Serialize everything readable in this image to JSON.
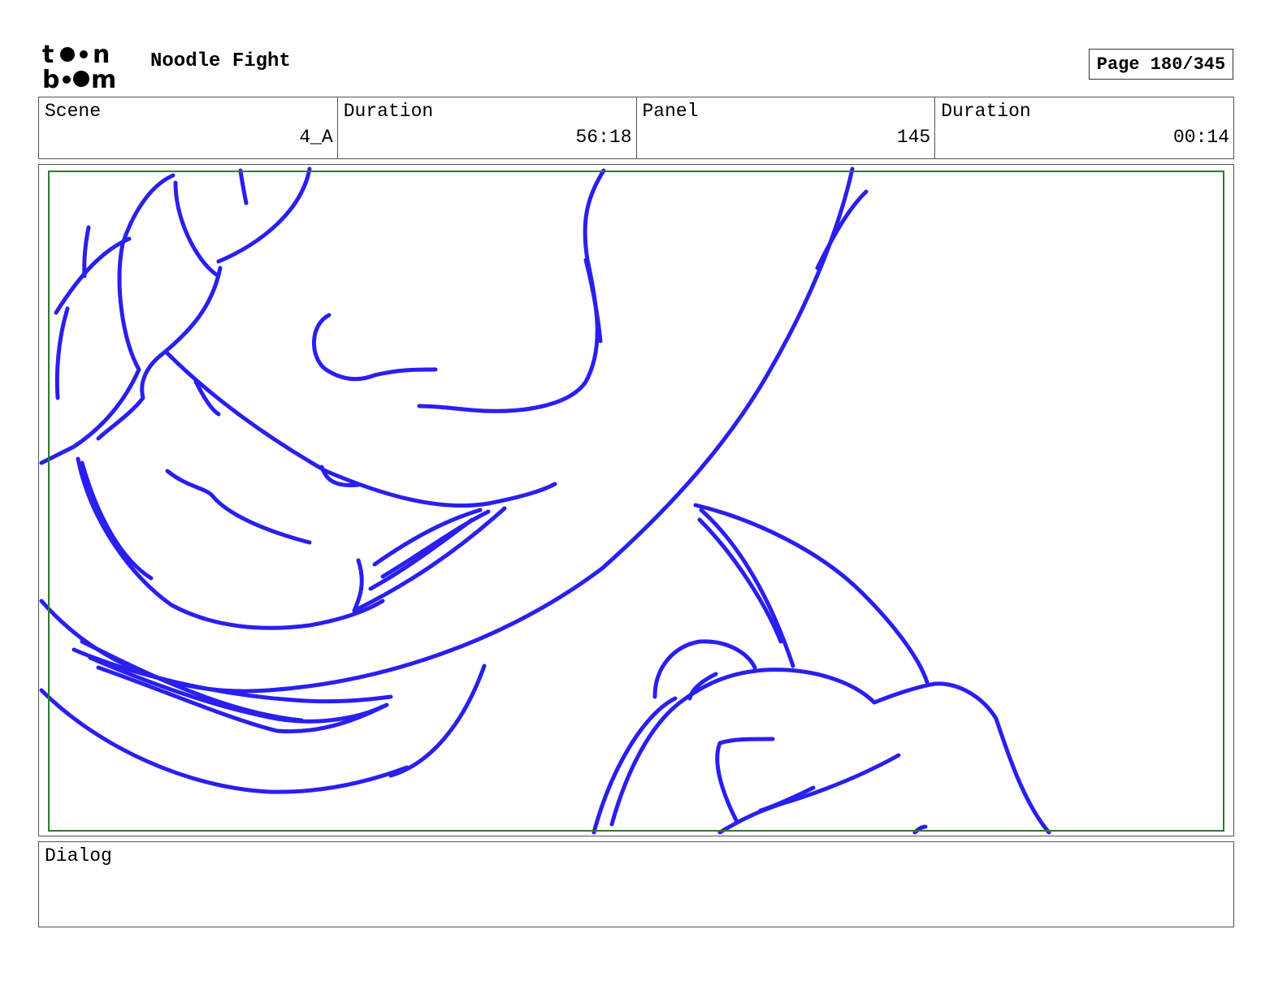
{
  "header": {
    "logo_top": "t●●n",
    "logo_bottom": "b●●m",
    "project_title": "Noodle Fight",
    "page_label": "Page 180/345"
  },
  "info": {
    "scene_label": "Scene",
    "scene_value": "4_A",
    "scene_duration_label": "Duration",
    "scene_duration_value": "56:18",
    "panel_label": "Panel",
    "panel_value": "145",
    "panel_duration_label": "Duration",
    "panel_duration_value": "00:14"
  },
  "dialog": {
    "label": "Dialog",
    "text": ""
  },
  "colors": {
    "sketch_stroke": "#2a1ff0",
    "safe_area": "#2f7a2f"
  }
}
